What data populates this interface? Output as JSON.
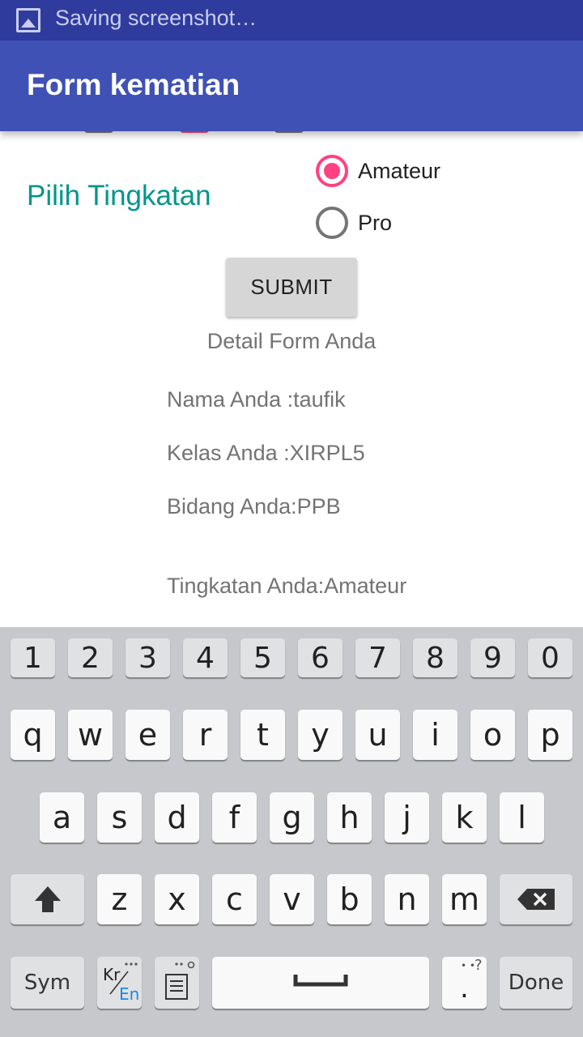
{
  "status_bar": {
    "text": "Saving screenshot…",
    "icon": "image-icon"
  },
  "toolbar": {
    "title": "Form kematian"
  },
  "form": {
    "level_label": "Pilih Tingkatan",
    "options": [
      {
        "label": "Amateur",
        "checked": true
      },
      {
        "label": "Pro",
        "checked": false
      }
    ],
    "submit_label": "SUBMIT"
  },
  "details": {
    "title": "Detail Form Anda",
    "lines": [
      "Nama Anda :taufik",
      "Kelas Anda :XIRPL5",
      "Bidang Anda:PPB",
      "Tingkatan Anda:Amateur"
    ]
  },
  "keyboard": {
    "row_numbers": [
      "1",
      "2",
      "3",
      "4",
      "5",
      "6",
      "7",
      "8",
      "9",
      "0"
    ],
    "row_1": [
      "q",
      "w",
      "e",
      "r",
      "t",
      "y",
      "u",
      "i",
      "o",
      "p"
    ],
    "row_2": [
      "a",
      "s",
      "d",
      "f",
      "g",
      "h",
      "j",
      "k",
      "l"
    ],
    "row_3": [
      "z",
      "x",
      "c",
      "v",
      "b",
      "n",
      "m"
    ],
    "sym_label": "Sym",
    "lang_top": "Kr",
    "lang_bottom": "En",
    "done_label": "Done",
    "period": ".",
    "punct_hint": "?"
  },
  "colors": {
    "status_bar": "#2f3c9e",
    "toolbar": "#3f51b5",
    "accent": "#ff4081",
    "label_teal": "#009688"
  }
}
